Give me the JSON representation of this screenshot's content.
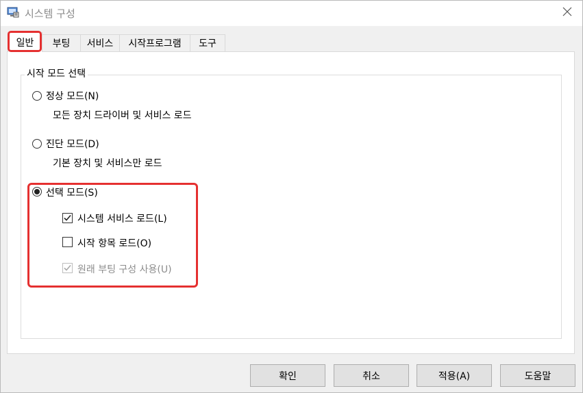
{
  "window": {
    "title": "시스템 구성"
  },
  "tabs": [
    {
      "label": "일반"
    },
    {
      "label": "부팅"
    },
    {
      "label": "서비스"
    },
    {
      "label": "시작프로그램"
    },
    {
      "label": "도구"
    }
  ],
  "startup": {
    "group_title": "시작 모드 선택",
    "normal": {
      "label": "정상 모드(N)",
      "desc": "모든 장치 드라이버 및 서비스 로드"
    },
    "diagnostic": {
      "label": "진단 모드(D)",
      "desc": "기본 장치 및 서비스만 로드"
    },
    "selective": {
      "label": "선택 모드(S)",
      "options": [
        {
          "label": "시스템 서비스 로드(L)",
          "checked": true,
          "enabled": true
        },
        {
          "label": "시작 항목 로드(O)",
          "checked": false,
          "enabled": true
        },
        {
          "label": "원래 부팅 구성 사용(U)",
          "checked": true,
          "enabled": false
        }
      ]
    },
    "selected_mode": "selective"
  },
  "buttons": {
    "ok": "확인",
    "cancel": "취소",
    "apply": "적용(A)",
    "help": "도움말"
  },
  "colors": {
    "highlight": "#e53030",
    "accent": "#1a6fd1"
  }
}
